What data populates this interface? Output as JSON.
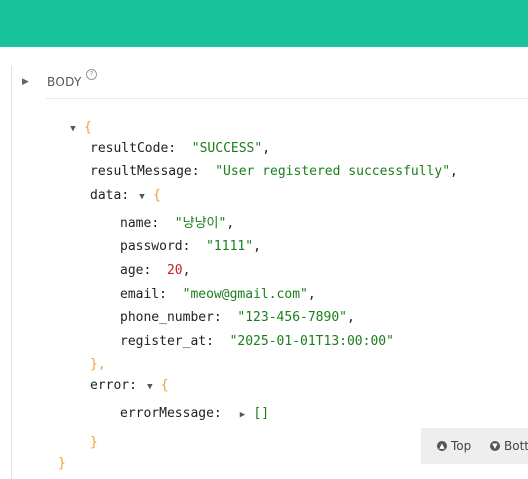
{
  "section": {
    "label": "BODY",
    "help": "?"
  },
  "tokens": {
    "open_brace": "{",
    "close_brace": "}",
    "close_brace_comma": "},",
    "colon": ":",
    "comma": ",",
    "empty_array": "[]"
  },
  "json": {
    "resultCode": {
      "key": "resultCode",
      "value": "\"SUCCESS\""
    },
    "resultMessage": {
      "key": "resultMessage",
      "value": "\"User registered successfully\""
    },
    "data": {
      "key": "data",
      "fields": [
        {
          "key": "name",
          "value": "\"냥냥이\"",
          "kind": "string"
        },
        {
          "key": "password",
          "value": "\"1111\"",
          "kind": "string"
        },
        {
          "key": "age",
          "value": "20",
          "kind": "number"
        },
        {
          "key": "email",
          "value": "\"meow@gmail.com\"",
          "kind": "string"
        },
        {
          "key": "phone_number",
          "value": "\"123-456-7890\"",
          "kind": "string"
        },
        {
          "key": "register_at",
          "value": "\"2025-01-01T13:00:00\"",
          "kind": "string"
        }
      ]
    },
    "error": {
      "key": "error",
      "errorMessage": {
        "key": "errorMessage"
      }
    }
  },
  "float_bar": {
    "top": "Top",
    "bottom": "Botto"
  },
  "colors": {
    "topbar": "#18c29c",
    "string": "#1a7f1a",
    "number": "#c02424",
    "bracket": "#f0a030"
  }
}
